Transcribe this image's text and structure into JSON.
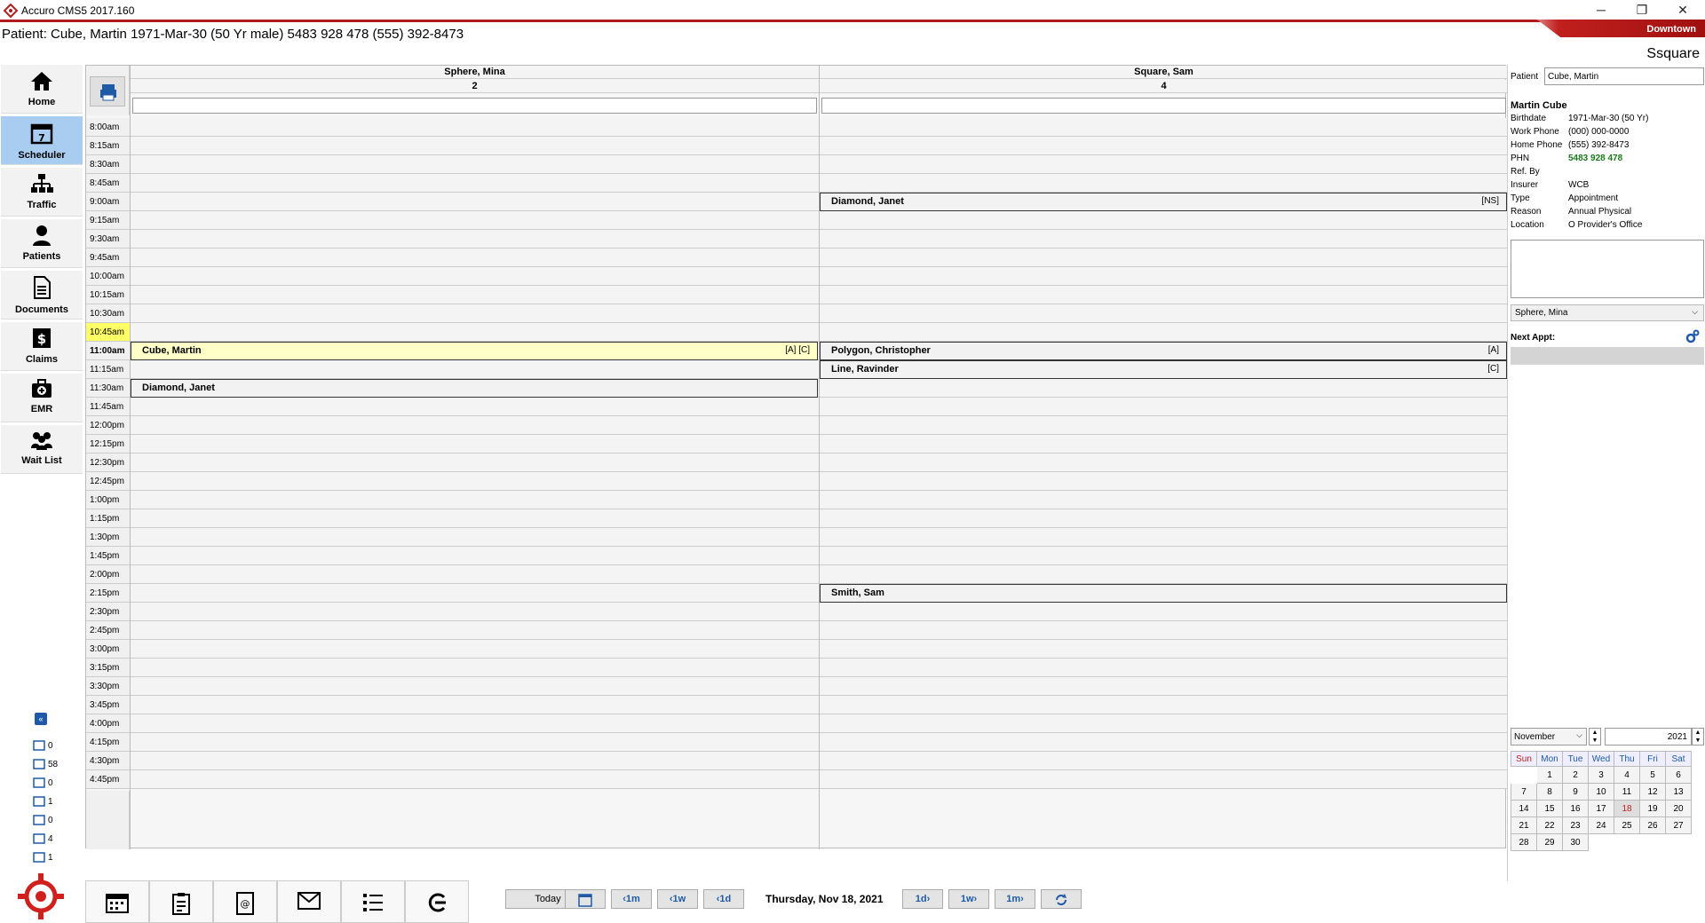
{
  "window": {
    "title": "Accuro CMS5 2017.160",
    "location": "Downtown",
    "user": "Ssquare"
  },
  "patient_bar": "Patient: Cube, Martin 1971-Mar-30 (50 Yr male) 5483 928 478 (555) 392-8473",
  "nav": [
    {
      "label": "Home",
      "icon": "home-icon",
      "active": false
    },
    {
      "label": "Scheduler",
      "icon": "calendar-icon",
      "active": true
    },
    {
      "label": "Traffic",
      "icon": "org-chart-icon",
      "active": false
    },
    {
      "label": "Patients",
      "icon": "person-icon",
      "active": false
    },
    {
      "label": "Documents",
      "icon": "document-icon",
      "active": false
    },
    {
      "label": "Claims",
      "icon": "dollar-icon",
      "active": false
    },
    {
      "label": "EMR",
      "icon": "medical-kit-icon",
      "active": false
    },
    {
      "label": "Wait List",
      "icon": "group-icon",
      "active": false
    }
  ],
  "status_counts": [
    {
      "icon": "contacts-icon",
      "count": "0"
    },
    {
      "icon": "mail-icon",
      "count": "58"
    },
    {
      "icon": "tasks-icon",
      "count": "0"
    },
    {
      "icon": "doc-icon",
      "count": "1"
    },
    {
      "icon": "lab-icon",
      "count": "0"
    },
    {
      "icon": "lab-results-icon",
      "count": "4"
    },
    {
      "icon": "message-icon",
      "count": "1"
    }
  ],
  "providers": [
    {
      "name": "Sphere, Mina",
      "count": "2"
    },
    {
      "name": "Square, Sam",
      "count": "4"
    }
  ],
  "times": [
    "8:00am",
    "8:15am",
    "8:30am",
    "8:45am",
    "9:00am",
    "9:15am",
    "9:30am",
    "9:45am",
    "10:00am",
    "10:15am",
    "10:30am",
    "10:45am",
    "11:00am",
    "11:15am",
    "11:30am",
    "11:45am",
    "12:00pm",
    "12:15pm",
    "12:30pm",
    "12:45pm",
    "1:00pm",
    "1:15pm",
    "1:30pm",
    "1:45pm",
    "2:00pm",
    "2:15pm",
    "2:30pm",
    "2:45pm",
    "3:00pm",
    "3:15pm",
    "3:30pm",
    "3:45pm",
    "4:00pm",
    "4:15pm",
    "4:30pm",
    "4:45pm"
  ],
  "highlight_time": "10:45am",
  "current_time": "11:00am",
  "appointments": [
    {
      "provider": 0,
      "slot": 12,
      "patient": "Cube, Martin",
      "flags": "[A] [C]",
      "selected": true
    },
    {
      "provider": 0,
      "slot": 14,
      "patient": "Diamond, Janet",
      "flags": "",
      "selected": false
    },
    {
      "provider": 1,
      "slot": 4,
      "patient": "Diamond, Janet",
      "flags": "[NS]",
      "selected": false
    },
    {
      "provider": 1,
      "slot": 12,
      "patient": "Polygon, Christopher",
      "flags": "[A]",
      "selected": false
    },
    {
      "provider": 1,
      "slot": 13,
      "patient": "Line, Ravinder",
      "flags": "[C]",
      "selected": false
    },
    {
      "provider": 1,
      "slot": 25,
      "patient": "Smith, Sam",
      "flags": "",
      "selected": false
    }
  ],
  "bottom_nav": {
    "today": "Today",
    "back_month": "‹1m",
    "back_week": "‹1w",
    "back_day": "‹1d",
    "date": "Thursday, Nov 18, 2021",
    "fwd_day": "1d›",
    "fwd_week": "1w›",
    "fwd_month": "1m›"
  },
  "right_panel": {
    "patient_label": "Patient",
    "patient_value": "Cube, Martin",
    "name": "Martin Cube",
    "details": [
      {
        "label": "Birthdate",
        "value": "1971-Mar-30 (50 Yr)"
      },
      {
        "label": "Work Phone",
        "value": "(000) 000-0000"
      },
      {
        "label": "Home Phone",
        "value": "(555) 392-8473"
      },
      {
        "label": "PHN",
        "value": "5483 928 478"
      },
      {
        "label": "Ref. By",
        "value": ""
      },
      {
        "label": "Insurer",
        "value": "WCB"
      },
      {
        "label": "Type",
        "value": "Appointment"
      },
      {
        "label": "Reason",
        "value": "Annual Physical"
      },
      {
        "label": "Location",
        "value": "O Provider's Office"
      }
    ],
    "provider_select": "Sphere, Mina",
    "next_appt_label": "Next Appt:",
    "month": "November",
    "year": "2021",
    "weekdays": [
      "Sun",
      "Mon",
      "Tue",
      "Wed",
      "Thu",
      "Fri",
      "Sat"
    ],
    "weeks": [
      [
        "",
        "1",
        "2",
        "3",
        "4",
        "5",
        "6"
      ],
      [
        "7",
        "8",
        "9",
        "10",
        "11",
        "12",
        "13"
      ],
      [
        "14",
        "15",
        "16",
        "17",
        "18",
        "19",
        "20"
      ],
      [
        "21",
        "22",
        "23",
        "24",
        "25",
        "26",
        "27"
      ],
      [
        "28",
        "29",
        "30",
        "",
        "",
        "",
        ""
      ]
    ],
    "today_day": "18"
  },
  "colors": {
    "accent": "#b01c1c",
    "nav_active": "#a8cdf0",
    "highlight": "#ffff66",
    "phn": "#1a7a1a",
    "link": "#1e5aa8"
  }
}
